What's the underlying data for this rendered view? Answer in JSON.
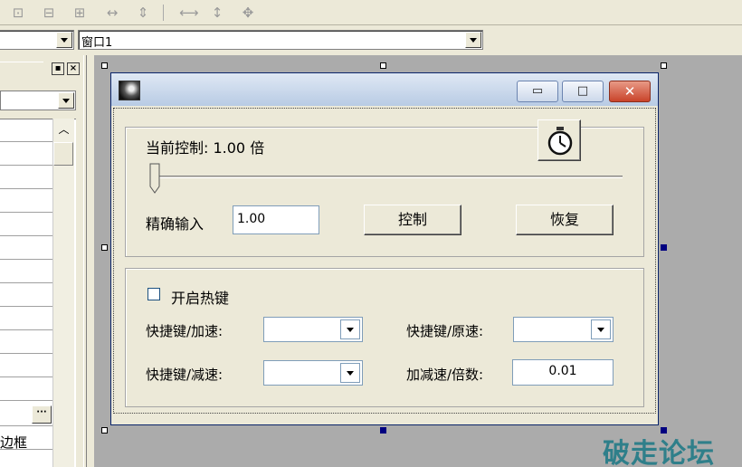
{
  "toolbar": {
    "icons": [
      "align-top-icon",
      "align-middle-icon",
      "align-bottom-icon",
      "same-width-icon",
      "center-vertical-icon",
      "center-horizontal-icon",
      "same-height-icon",
      "center-both-icon"
    ]
  },
  "combo_row": {
    "window_select_value": "窗口1"
  },
  "left_panel": {
    "text_fragment": "边框"
  },
  "window": {
    "min_glyph": "▭",
    "max_glyph": "□",
    "close_glyph": "✕",
    "current_control_label": "当前控制: 1.00 倍",
    "precise_input_label": "精确输入",
    "precise_input_value": "1.00",
    "control_button": "控制",
    "restore_button": "恢复",
    "slider_value": 0,
    "hotkey_checkbox_label": "开启热键",
    "hotkey_checked": false,
    "speedup_label": "快捷键/加速:",
    "restore_hotkey_label": "快捷键/原速:",
    "slowdown_label": "快捷键/减速:",
    "step_label": "加减速/倍数:",
    "step_value": "0.01"
  },
  "watermark": "破走论坛",
  "colors": {
    "title_gradient_top": "#dfe8f4",
    "close_button": "#c9432a",
    "canvas_bg": "#ababab",
    "watermark": "#2f7f8a"
  }
}
